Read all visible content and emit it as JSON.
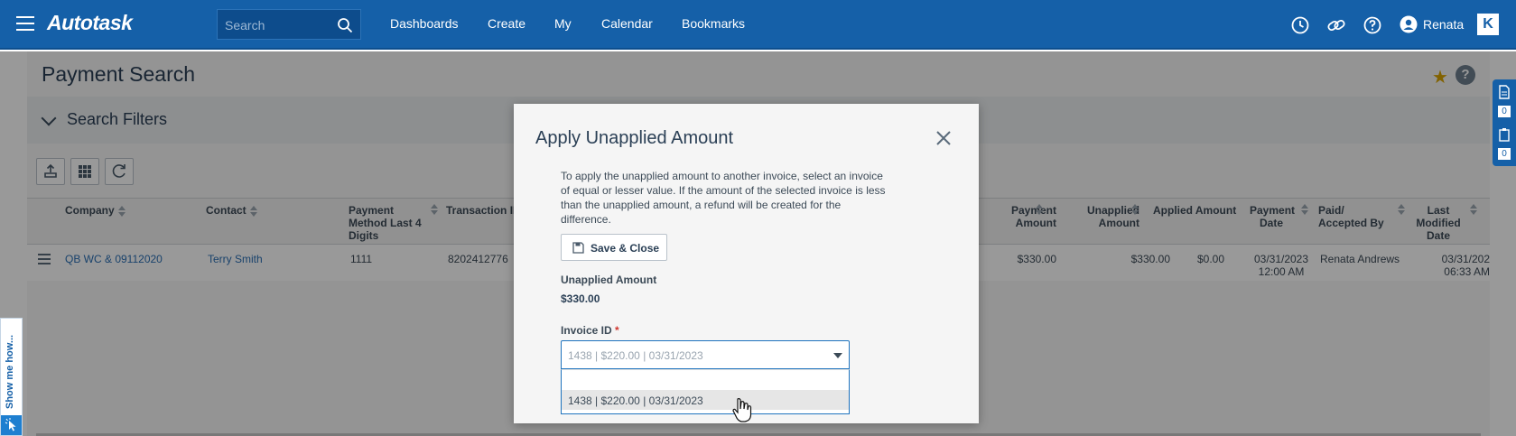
{
  "app": {
    "logo": "Autotask",
    "search_placeholder": "Search",
    "nav": [
      "Dashboards",
      "Create",
      "My",
      "Calendar",
      "Bookmarks"
    ],
    "user_name": "Renata",
    "k_tile": "K"
  },
  "page": {
    "title": "Payment Search",
    "filters_label": "Search Filters",
    "columns": {
      "company": "Company",
      "contact": "Contact",
      "payment_method": [
        "Payment",
        "Method Last 4",
        "Digits"
      ],
      "transaction_id": "Transaction ID",
      "payment_amount": [
        "Payment",
        "Amount"
      ],
      "unapplied_amount": [
        "Unapplied",
        "Amount"
      ],
      "applied_amount": "Applied Amount",
      "payment_date": [
        "Payment",
        "Date"
      ],
      "paid_by": [
        "Paid/",
        "Accepted By"
      ],
      "last_modified": [
        "Last",
        "Modified",
        "Date"
      ]
    },
    "row": {
      "company": "QB WC & 09112020",
      "contact": "Terry Smith",
      "method_digits": "1111",
      "transaction_id": "8202412776",
      "payment_amount": "$330.00",
      "unapplied_amount": "$330.00",
      "applied_amount": "$0.00",
      "payment_date": [
        "03/31/2023",
        "12:00 AM"
      ],
      "paid_by": "Renata Andrews",
      "last_modified": [
        "03/31/202",
        "06:33 AM"
      ]
    }
  },
  "side_panel": {
    "counts": [
      "0",
      "0"
    ]
  },
  "show_me": {
    "label": "Show me how..."
  },
  "modal": {
    "title": "Apply Unapplied Amount",
    "description": "To apply the unapplied amount to another invoice, select an invoice of equal or lesser value. If the amount of the selected invoice is less than the unapplied amount, a refund will be created for the difference.",
    "save_label": "Save & Close",
    "unapplied_label": "Unapplied Amount",
    "unapplied_value": "$330.00",
    "invoice_label": "Invoice ID",
    "required_mark": "*",
    "selected_value": "1438 | $220.00 | 03/31/2023",
    "options": [
      "1438 | $220.00 | 03/31/2023"
    ]
  },
  "colors": {
    "brand_blue": "#1560a8",
    "link_blue": "#2a6fb4",
    "required_red": "#d0352e",
    "star_gold": "#d9a400"
  }
}
